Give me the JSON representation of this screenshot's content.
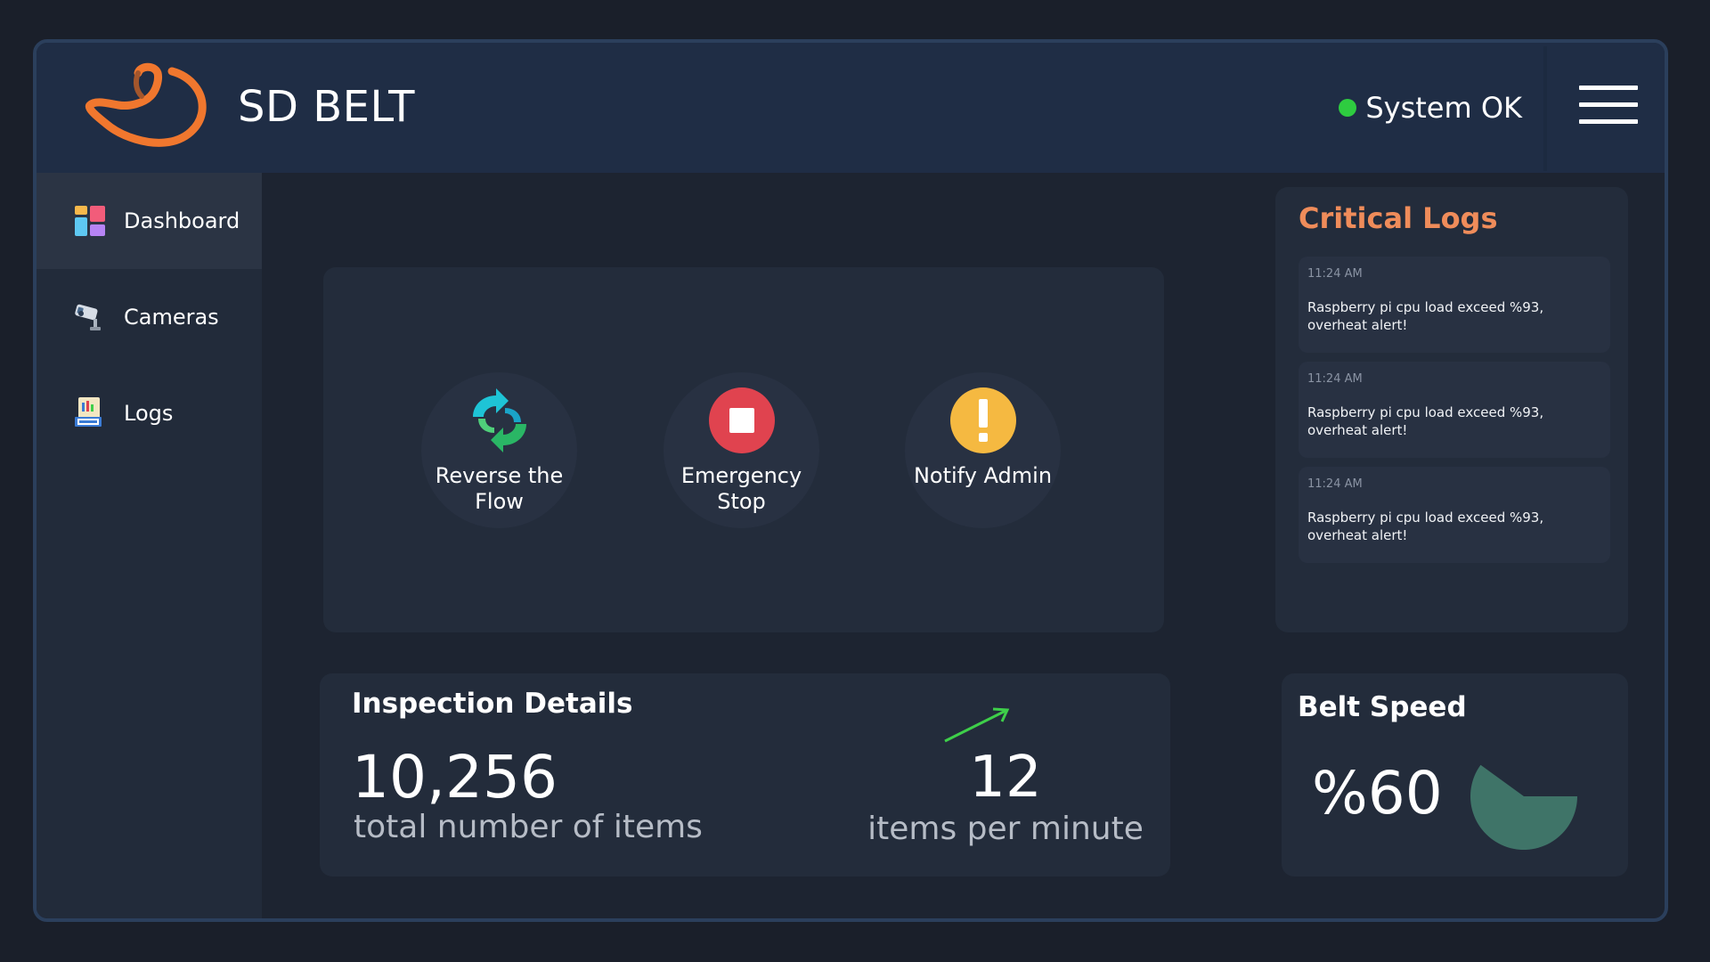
{
  "header": {
    "brand": "SD BELT",
    "status_text": "System OK",
    "status_color": "#2ecc40",
    "menu_icon": "hamburger-menu-icon",
    "logo_icon": "orange-hat-logo"
  },
  "sidebar": {
    "items": [
      {
        "label": "Dashboard",
        "icon": "dashboard-grid-icon",
        "active": true
      },
      {
        "label": "Cameras",
        "icon": "security-camera-icon",
        "active": false
      },
      {
        "label": "Logs",
        "icon": "log-file-icon",
        "active": false
      }
    ]
  },
  "actions": [
    {
      "label": "Reverse the Flow",
      "icon": "reverse-arrows-icon"
    },
    {
      "label": "Emergency Stop",
      "icon": "stop-icon",
      "color": "#e0434f"
    },
    {
      "label": "Notify Admin",
      "icon": "exclamation-icon",
      "color": "#f5b941"
    }
  ],
  "critical_logs": {
    "title": "Critical Logs",
    "title_color": "#ef8c5a",
    "entries": [
      {
        "time": "11:24 AM",
        "message": "Raspberry pi cpu load exceed %93, overheat alert!"
      },
      {
        "time": "11:24 AM",
        "message": "Raspberry pi cpu load exceed %93, overheat alert!"
      },
      {
        "time": "11:24 AM",
        "message": "Raspberry pi cpu load exceed %93, overheat alert!"
      }
    ]
  },
  "inspection": {
    "title": "Inspection Details",
    "total_value": "10,256",
    "total_label": "total number of items",
    "rate_value": "12",
    "rate_label": "items per minute",
    "trend_icon": "trend-up-arrow-icon",
    "trend_color": "#3ecf4a"
  },
  "belt_speed": {
    "title": "Belt Speed",
    "value_text": "%60",
    "fraction": 0.6,
    "pie_color": "#3f7468"
  }
}
